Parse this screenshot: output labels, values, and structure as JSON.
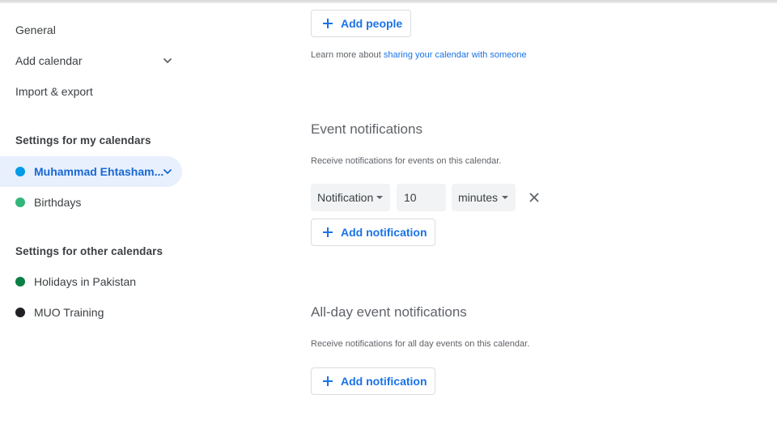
{
  "sidebar": {
    "general": "General",
    "add_calendar": "Add calendar",
    "import_export": "Import & export",
    "my_calendars_heading": "Settings for my calendars",
    "my_calendars": [
      {
        "label": "Muhammad Ehtasham...",
        "color": "#039be5",
        "selected": true
      },
      {
        "label": "Birthdays",
        "color": "#33b679",
        "selected": false
      }
    ],
    "other_calendars_heading": "Settings for other calendars",
    "other_calendars": [
      {
        "label": "Holidays in Pakistan",
        "color": "#0b8043"
      },
      {
        "label": "MUO Training",
        "color": "#202124"
      }
    ]
  },
  "sharing": {
    "add_people_label": "Add people",
    "learn_more_prefix": "Learn more about ",
    "learn_more_link": "sharing your calendar with someone"
  },
  "event_notifications": {
    "title": "Event notifications",
    "description": "Receive notifications for events on this calendar.",
    "type_value": "Notification",
    "amount_value": "10",
    "unit_value": "minutes",
    "add_label": "Add notification"
  },
  "allday_notifications": {
    "title": "All-day event notifications",
    "description": "Receive notifications for all day events on this calendar.",
    "add_label": "Add notification"
  },
  "colors": {
    "accent": "#1a73e8",
    "selected_bg": "#e8f0fe"
  }
}
